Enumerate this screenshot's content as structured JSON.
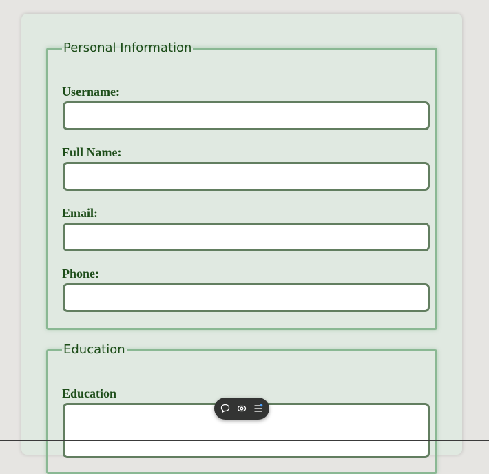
{
  "sections": {
    "personal": {
      "legend": "Personal Information",
      "fields": {
        "username": {
          "label": "Username:",
          "value": ""
        },
        "full_name": {
          "label": "Full Name:",
          "value": ""
        },
        "email": {
          "label": "Email:",
          "value": ""
        },
        "phone": {
          "label": "Phone:",
          "value": ""
        }
      }
    },
    "education": {
      "legend": "Education",
      "field": {
        "label": "Education",
        "value": ""
      }
    }
  },
  "toolbar": {
    "icons": [
      "comment-icon",
      "eye-icon",
      "list-settings-icon"
    ]
  },
  "colors": {
    "page_bg": "#e6e5e2",
    "card_bg": "#e0e9e1",
    "fieldset_border": "#8ab893",
    "label_text": "#1d4d19",
    "input_border": "#627e60",
    "toolbar_bg": "#333433"
  }
}
